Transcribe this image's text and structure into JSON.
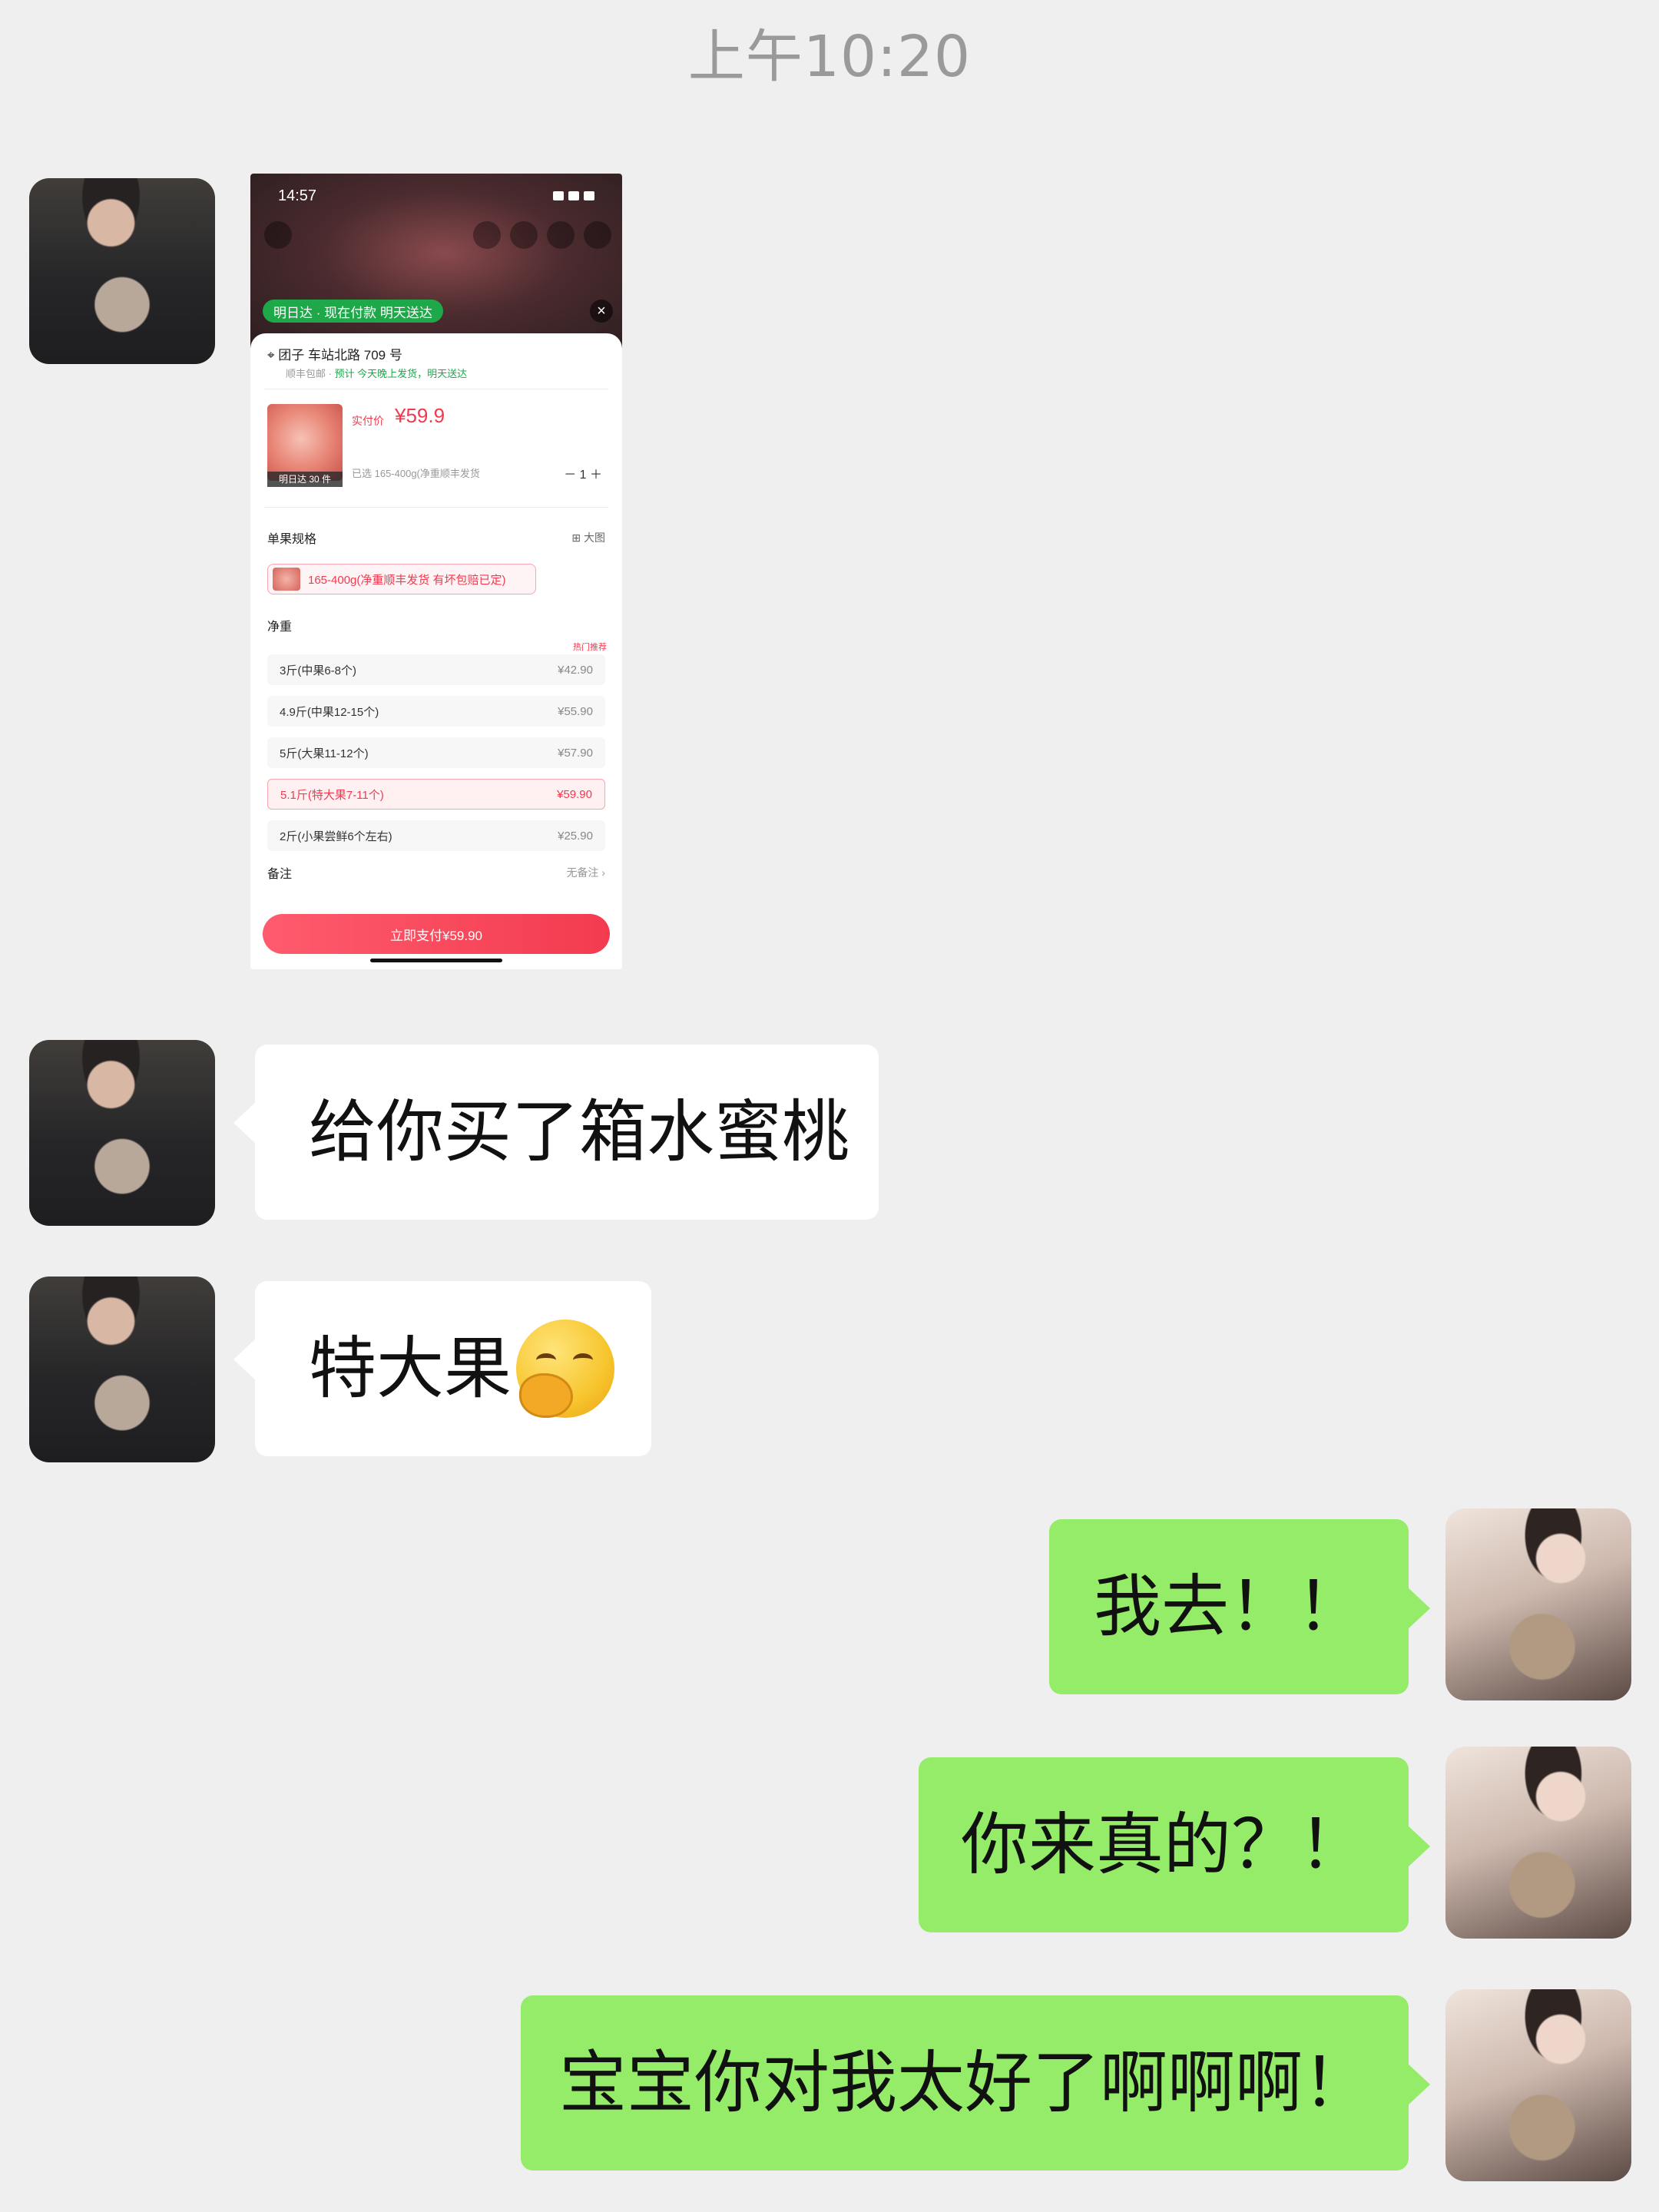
{
  "timestamp": "上午10:20",
  "messages": [
    {
      "side": "left",
      "type": "image"
    },
    {
      "side": "left",
      "type": "text",
      "text": "给你买了箱水蜜桃"
    },
    {
      "side": "left",
      "type": "text",
      "text": "特大果",
      "emoji": "hand-over-mouth-emoji"
    },
    {
      "side": "right",
      "type": "text",
      "text": "我去！！"
    },
    {
      "side": "right",
      "type": "text",
      "text": "你来真的？！"
    },
    {
      "side": "right",
      "type": "text",
      "text": "宝宝你对我太好了啊啊啊！"
    }
  ],
  "screenshot": {
    "time": "14:57",
    "delivery_pill": "明日达 · 现在付款 明天送达",
    "address": "团子  车站北路 709 号",
    "address_sub_prefix": "顺丰包邮 · ",
    "address_sub_green": "预计 今天晚上发货，明天送达",
    "price_label": "实付价",
    "price": "¥59.9",
    "thumb_tag": "明日达 30 件",
    "selected_spec": "已选 165-400g(净重顺丰发货",
    "quantity": "－   1   ＋",
    "spec_heading": "单果规格",
    "big_image": "大图",
    "spec_chip": "165-400g(净重顺丰发货 有坏包赔已定)",
    "weight_heading": "净重",
    "hot_tag": "热门推荐",
    "options": [
      {
        "label": "3斤(中果6-8个)",
        "price": "¥42.90",
        "selected": false
      },
      {
        "label": "4.9斤(中果12-15个)",
        "price": "¥55.90",
        "selected": false
      },
      {
        "label": "5斤(大果11-12个)",
        "price": "¥57.90",
        "selected": false
      },
      {
        "label": "5.1斤(特大果7-11个)",
        "price": "¥59.90",
        "selected": true
      },
      {
        "label": "2斤(小果尝鲜6个左右)",
        "price": "¥25.90",
        "selected": false
      }
    ],
    "note_label": "备注",
    "note_value": "无备注 ›",
    "pay_button": "立即支付¥59.90"
  }
}
